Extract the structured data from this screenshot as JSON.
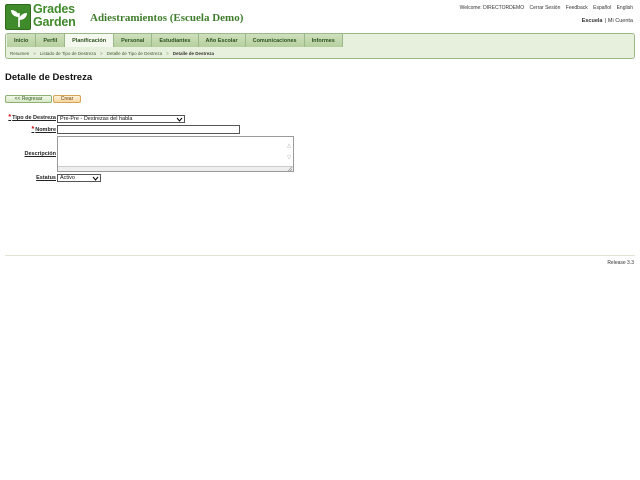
{
  "header": {
    "logo_line1": "Grades",
    "logo_line2": "Garden",
    "app_title": "Adiestramientos (Escuela Demo)",
    "welcome_prefix": "Welcome:",
    "username": "DIRECTORDEMO",
    "logout": "Cerrar Sesión",
    "feedback": "Feedback",
    "lang_es": "Español",
    "lang_en": "English",
    "school": "Escuela",
    "account": "Mi Cuenta",
    "brand_color": "#3f8a2a"
  },
  "nav": {
    "tabs": [
      "Inicio",
      "Perfil",
      "Planificación",
      "Personal",
      "Estudiantes",
      "Año Escolar",
      "Comunicaciones",
      "Informes"
    ],
    "active_tab": "Planificación",
    "breadcrumb": [
      "Resumen",
      "Listado de Tipo de Destreza",
      "Detalle de Tipo de Destreza",
      "Detalle de Destreza"
    ]
  },
  "page": {
    "title": "Detalle de Destreza",
    "back_button": "<< Regresar",
    "create_button": "Crear"
  },
  "form": {
    "tipo_label": "Tipo de Destreza",
    "tipo_value": "Pre-Pre - Destrezas del habla",
    "nombre_label": "Nombre",
    "nombre_value": "",
    "descripcion_label": "Descripción",
    "descripcion_value": "",
    "estatus_label": "Estatus",
    "estatus_value": "Activo",
    "required_mark": "*"
  },
  "footer": {
    "release": "Release 3.3"
  }
}
